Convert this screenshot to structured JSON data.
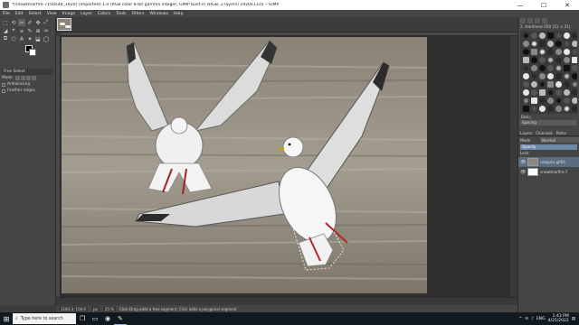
{
  "window": {
    "title": "*[snowtmarfire-7150548_1920] (imported)-1.0 (RGB color 8-bit gamma integer, GIMP built-in sRGB, 2 layers) 1920x1315 – GIMP",
    "minimize_label": "—",
    "maximize_label": "☐",
    "close_label": "✕"
  },
  "menu": [
    "File",
    "Edit",
    "Select",
    "View",
    "Image",
    "Layer",
    "Colors",
    "Tools",
    "Filters",
    "Windows",
    "Help"
  ],
  "toolbox": {
    "tools": [
      "⬚",
      "⟲",
      "✂",
      "✐",
      "✥",
      "⤢",
      "◢",
      "⌖",
      "⌀",
      "✎",
      "⊕",
      "♒",
      "⧉",
      "⬡",
      "A",
      "✦",
      "⬓",
      "◯"
    ],
    "options": {
      "title": "Free Select",
      "mode_label": "Mode",
      "antialiasing_label": "Antialiasing",
      "feather_label": "Feather edges"
    }
  },
  "canvas": {
    "accent": "#6e8aa8"
  },
  "statusbar": {
    "coords": "1183.3, 104.0",
    "unit": "px",
    "zoom": "25 %",
    "message": "Click-Drag adds a free segment, Click adds a polygonal segment"
  },
  "dock": {
    "brush_name": "2. Hardness 050 (51 × 51)",
    "brush_category": "Basic,",
    "spacing_label": "Spacing",
    "tabs": [
      "Layers",
      "Channels",
      "Paths"
    ],
    "mode_label": "Mode",
    "mode_value": "Normal",
    "opacity_label": "Opacity",
    "lock_label": "Lock:",
    "layers": [
      {
        "name": "seagulls.gif64",
        "selected": true,
        "photo": true
      },
      {
        "name": "snowtmarfire-7",
        "selected": false,
        "photo": false
      }
    ]
  },
  "taskbar": {
    "search_placeholder": "Type here to search",
    "keyboard": "ENG",
    "time": "1:43 PM",
    "date": "4/25/2022"
  }
}
